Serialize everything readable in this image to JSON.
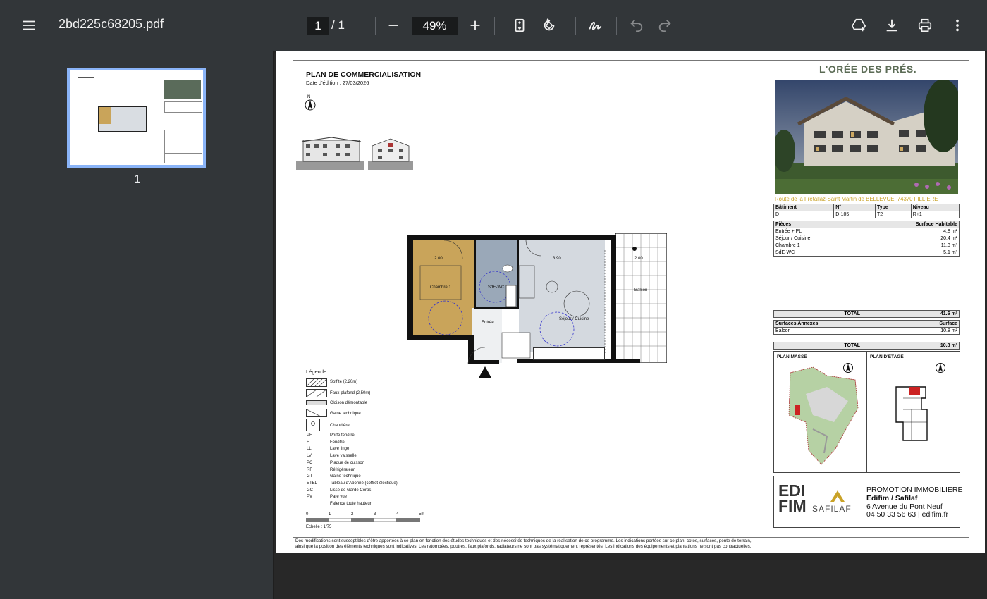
{
  "toolbar": {
    "title": "2bd225c68205.pdf",
    "page_current": "1",
    "page_total": "/  1",
    "zoom": "49%"
  },
  "sidebar": {
    "thumbnail_label": "1"
  },
  "document": {
    "heading": "PLAN DE COMMERCIALISATION",
    "date_line": "Date d'édition :   27/03/2026",
    "north": "N",
    "brand": "L'ORÉE DES PRÉS.",
    "address": "Route de la Frétallaz-Saint Martin de BELLEVUE, 74370 FILLIERE",
    "lot_headers": [
      "Bâtiment",
      "N°",
      "Type",
      "Niveau"
    ],
    "lot_values": [
      "D",
      "D-105",
      "T2",
      "R+1"
    ],
    "rooms_header": [
      "Pièces",
      "Surface Habitable"
    ],
    "rooms": [
      {
        "name": "Entrée  + PL",
        "area": "4.8 m²"
      },
      {
        "name": "Séjour / Cuisine",
        "area": "20.4 m²"
      },
      {
        "name": "Chambre 1",
        "area": "11.3 m²"
      },
      {
        "name": "SdE-WC",
        "area": "5.1 m²"
      }
    ],
    "total_label": "TOTAL",
    "total_habitable": "41.6 m²",
    "annex_header": [
      "Surfaces Annexes",
      "Surface"
    ],
    "annex": [
      {
        "name": "Balcon",
        "area": "10.8 m²"
      }
    ],
    "total_annex": "10.8 m²",
    "plan_masse": "PLAN MASSE",
    "plan_etage": "PLAN D'ETAGE",
    "promo_title": "PROMOTION IMMOBILIERE",
    "promo_company": "Edifim / Safilaf",
    "promo_address": "6 Avenue du Pont Neuf",
    "promo_contact": "04 50 33 56 63 | edifim.fr",
    "logo_edifim_1": "EDI",
    "logo_edifim_2": "FIM",
    "logo_safilaf": "SAFILAF",
    "legend_title": "Légende:",
    "legend_swatches": [
      "Soffite (2,20m)",
      "Faux-plafond (2,50m)",
      "Cloison démontable",
      "Gaine technique",
      "Chaudière"
    ],
    "legend_abbr": [
      {
        "code": "PF",
        "label": "Porte fenêtre"
      },
      {
        "code": "F",
        "label": "Fenêtre"
      },
      {
        "code": "LL",
        "label": "Lave linge"
      },
      {
        "code": "LV",
        "label": "Lave vaisselle"
      },
      {
        "code": "PC",
        "label": "Plaque de cuisson"
      },
      {
        "code": "RF",
        "label": "Réfrigérateur"
      },
      {
        "code": "GT",
        "label": "Gaine technique"
      },
      {
        "code": "ETEL",
        "label": "Tableau d'Abonné (coffret électique)"
      },
      {
        "code": "GC",
        "label": "Lisse de Garde Corps"
      },
      {
        "code": "PV",
        "label": "Pare vue"
      }
    ],
    "legend_faience": "Faïence toute hauteur",
    "scale_ticks": [
      "0",
      "1",
      "2",
      "3",
      "4",
      "5m"
    ],
    "scale_label": "Echelle : 1/75",
    "rooms_on_plan": {
      "chambre": "Chambre 1",
      "sde": "SdE-WC",
      "entree": "Entrée",
      "sejour": "Séjour / Cuisine",
      "balcon": "Balcon"
    },
    "plan_dims": {
      "d1": "2.00",
      "d2": "3.90",
      "d3": "2.00"
    },
    "disclaimer_1": "Des modifications sont susceptibles d'être apportées à ce plan en fonction des études techniques et des nécessités techniques de la réalisation de ce programme.   Les indications portées sur ce plan, cotes, surfaces, pente de terrain,",
    "disclaimer_2": "ainsi que la position des éléments techniques sont indicatives;  Les retombées, poutres, faux plafonds, radiateurs ne sont pas systématiquement représentés. Les indications des équipements et plantations ne sont pas contractuelles."
  },
  "colors": {
    "toolbar": "#323639",
    "background": "#282828",
    "thumb_highlight": "#8ab4f8",
    "brand_gold": "#c9a227",
    "bedroom_fill": "#c9a45a",
    "bath_fill": "#9aa8b8",
    "living_fill": "#d4d9df"
  }
}
